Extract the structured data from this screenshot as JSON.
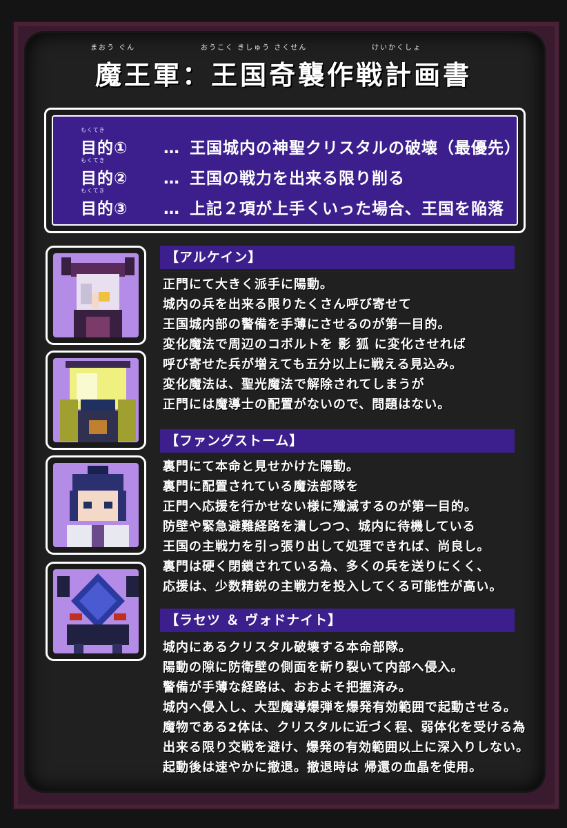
{
  "title": {
    "text": "魔王軍：王国奇襲作戦計画書",
    "ruby": [
      "まおう ぐん",
      "おうこく きしゅう さくせん",
      "けいかくしょ"
    ]
  },
  "objectives": [
    {
      "label": "目的①",
      "dots": "…",
      "text": "王国城内の神聖クリスタルの破壊（最優先）",
      "ruby": "もくてき"
    },
    {
      "label": "目的②",
      "dots": "…",
      "text": "王国の戦力を出来る限り削る",
      "ruby": "もくてき"
    },
    {
      "label": "目的③",
      "dots": "…",
      "text": "上記２項が上手くいった場合、王国を陥落",
      "ruby": "もくてき"
    }
  ],
  "sections": [
    {
      "header": "【アルケイン】",
      "lines": [
        "正門にて大きく派手に陽動。",
        "城内の兵を出来る限りたくさん呼び寄せて",
        "王国城内部の警備を手薄にさせるのが第一目的。",
        "変化魔法で周辺のコボルトを 影 狐 に変化させれば",
        "呼び寄せた兵が増えても五分以上に戦える見込み。",
        "変化魔法は、聖光魔法で解除されてしまうが",
        "正門には魔導士の配置がないので、問題はない。"
      ]
    },
    {
      "header": "【ファングストーム】",
      "lines": [
        "裏門にて本命と見せかけた陽動。",
        "裏門に配置されている魔法部隊を",
        "正門へ応援を行かせない様に殲滅するのが第一目的。",
        "防壁や緊急避難経路を潰しつつ、城内に待機している",
        "王国の主戦力を引っ張り出して処理できれば、尚良し。",
        "裏門は硬く閉鎖されている為、多くの兵を送りにくく、",
        "応援は、少数精鋭の主戦力を投入してくる可能性が高い。"
      ]
    },
    {
      "header": "【ラセツ ＆ ヴォドナイト】",
      "lines": [
        "城内にあるクリスタル破壊する本命部隊。",
        "陽動の隙に防衛壁の側面を斬り裂いて内部へ侵入。",
        "警備が手薄な経路は、おおよそ把握済み。",
        "城内へ侵入し、大型魔導爆弾を爆発有効範囲で起動させる。",
        "魔物である2体は、クリスタルに近づく程、弱体化を受ける為",
        "出来る限り交戦を避け、爆発の有効範囲以上に深入りしない。",
        "起動後は速やかに撤退。撤退時は 帰還の血晶を使用。"
      ]
    }
  ],
  "portraits": [
    {
      "name": "アルケイン",
      "icon": "white-haired-horned-girl"
    },
    {
      "name": "ファングストーム",
      "icon": "yellow-armored-knight"
    },
    {
      "name": "ラセツ",
      "icon": "blue-haired-girl"
    },
    {
      "name": "ヴォドナイト",
      "icon": "blue-crystal-demon"
    }
  ],
  "colors": {
    "panel": "#202020",
    "accent": "#3c1f8c",
    "portrait_bg": "#b48be6",
    "frame": "#3a1a2e"
  }
}
